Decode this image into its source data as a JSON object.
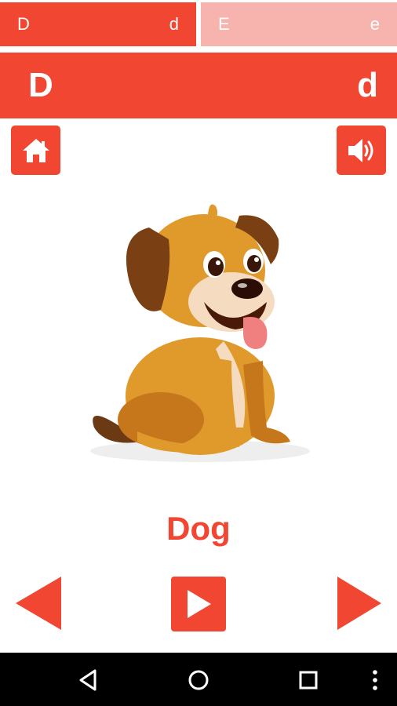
{
  "tabs": [
    {
      "upper": "D",
      "lower": "d",
      "active": true
    },
    {
      "upper": "E",
      "lower": "e",
      "active": false
    }
  ],
  "banner": {
    "upper": "D",
    "lower": "d"
  },
  "card": {
    "word": "Dog",
    "image": "dog-illustration"
  },
  "icons": {
    "home": "home-icon",
    "sound": "speaker-icon",
    "prev": "previous-arrow-icon",
    "play": "play-icon",
    "next": "next-arrow-icon"
  },
  "system_nav": [
    "back-icon",
    "home-circle-icon",
    "recents-icon",
    "overflow-menu-icon"
  ],
  "colors": {
    "accent": "#f04632",
    "accent_light": "#f7b3ae",
    "navbar": "#000000"
  }
}
